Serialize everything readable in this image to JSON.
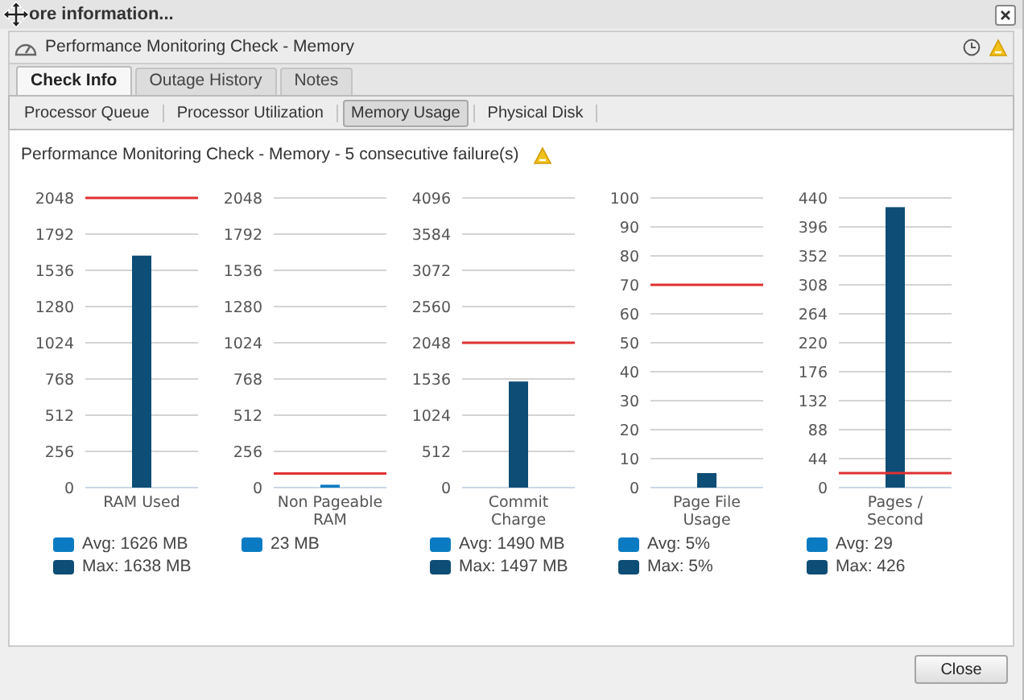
{
  "window": {
    "title": "ore information..."
  },
  "panel": {
    "title": "Performance Monitoring Check - Memory"
  },
  "tabs": [
    {
      "label": "Check Info",
      "selected": true
    },
    {
      "label": "Outage History",
      "selected": false
    },
    {
      "label": "Notes",
      "selected": false
    }
  ],
  "subtabs": [
    {
      "label": "Processor Queue",
      "selected": false
    },
    {
      "label": "Processor Utilization",
      "selected": false
    },
    {
      "label": "Memory Usage",
      "selected": true
    },
    {
      "label": "Physical Disk",
      "selected": false
    }
  ],
  "heading": "Performance Monitoring Check - Memory - 5 consecutive failure(s)",
  "charts": [
    {
      "chart_data": {
        "type": "bar",
        "categories": [
          "RAM Used"
        ],
        "series": [
          {
            "color": "#0e4d75",
            "values": [
              1640
            ]
          }
        ],
        "ylim": [
          0,
          2048
        ],
        "yticks": [
          0,
          256,
          512,
          768,
          1024,
          1280,
          1536,
          1792,
          2048
        ],
        "grid": true,
        "ref_lines": [
          {
            "axis": "y",
            "value": 2048,
            "color": "#e03131"
          }
        ]
      },
      "legend": [
        {
          "label": "Avg: 1626 MB",
          "color": "#0a7bc2"
        },
        {
          "label": "Max: 1638 MB",
          "color": "#0e4d75"
        }
      ]
    },
    {
      "chart_data": {
        "type": "bar",
        "categories": [
          "Non Pageable RAM"
        ],
        "series": [
          {
            "color": "#0a7bc2",
            "values": [
              20
            ]
          }
        ],
        "ylim": [
          0,
          2048
        ],
        "yticks": [
          0,
          256,
          512,
          768,
          1024,
          1280,
          1536,
          1792,
          2048
        ],
        "grid": true,
        "ref_lines": [
          {
            "axis": "y",
            "value": 100,
            "color": "#e03131"
          }
        ]
      },
      "legend": [
        {
          "label": "23 MB",
          "color": "#0a7bc2"
        }
      ]
    },
    {
      "chart_data": {
        "type": "bar",
        "categories": [
          "Commit Charge"
        ],
        "series": [
          {
            "color": "#0e4d75",
            "values": [
              1500
            ]
          }
        ],
        "ylim": [
          0,
          4096
        ],
        "yticks": [
          0,
          512,
          1024,
          1536,
          2048,
          2560,
          3072,
          3584,
          4096
        ],
        "grid": true,
        "ref_lines": [
          {
            "axis": "y",
            "value": 2048,
            "color": "#e03131"
          }
        ]
      },
      "legend": [
        {
          "label": "Avg: 1490 MB",
          "color": "#0a7bc2"
        },
        {
          "label": "Max: 1497 MB",
          "color": "#0e4d75"
        }
      ]
    },
    {
      "chart_data": {
        "type": "bar",
        "categories": [
          "Page File Usage"
        ],
        "series": [
          {
            "color": "#0e4d75",
            "values": [
              5
            ]
          }
        ],
        "ylim": [
          0,
          100
        ],
        "yticks": [
          0,
          10,
          20,
          30,
          40,
          50,
          60,
          70,
          80,
          90,
          100
        ],
        "grid": true,
        "ref_lines": [
          {
            "axis": "y",
            "value": 70,
            "color": "#e03131"
          }
        ]
      },
      "legend": [
        {
          "label": "Avg: 5%",
          "color": "#0a7bc2"
        },
        {
          "label": "Max: 5%",
          "color": "#0e4d75"
        }
      ]
    },
    {
      "chart_data": {
        "type": "bar",
        "categories": [
          "Pages / Second"
        ],
        "series": [
          {
            "color": "#0e4d75",
            "values": [
              426
            ]
          }
        ],
        "ylim": [
          0,
          440
        ],
        "yticks": [
          0,
          44,
          88,
          132,
          176,
          220,
          264,
          308,
          352,
          396,
          440
        ],
        "grid": true,
        "ref_lines": [
          {
            "axis": "y",
            "value": 22,
            "color": "#e03131"
          }
        ]
      },
      "legend": [
        {
          "label": "Avg: 29",
          "color": "#0a7bc2"
        },
        {
          "label": "Max: 426",
          "color": "#0e4d75"
        }
      ]
    }
  ],
  "buttons": [
    {
      "label": "Close"
    }
  ]
}
